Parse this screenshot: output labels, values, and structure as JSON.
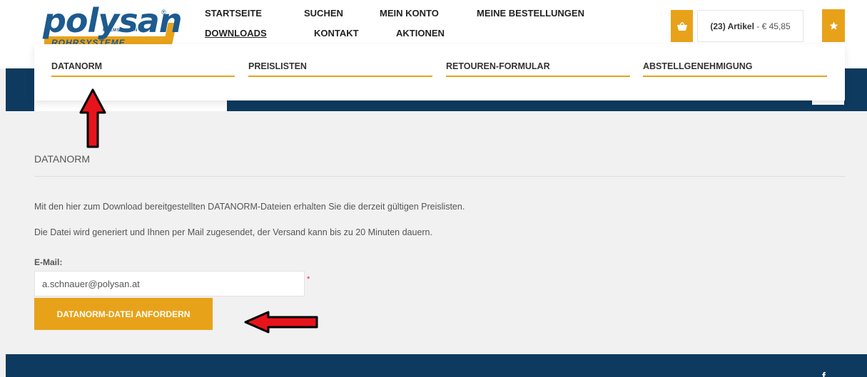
{
  "logo": {
    "brand": "polysan",
    "sub": "KREMS · WIEN",
    "tagline": "ROHRSYSTEME",
    "registered": "®"
  },
  "nav": {
    "row1": [
      "STARTSEITE",
      "SUCHEN",
      "MEIN KONTO",
      "MEINE BESTELLUNGEN"
    ],
    "row2": [
      "DOWNLOADS",
      "KONTAKT",
      "AKTIONEN"
    ]
  },
  "cart": {
    "count": "(23) Artikel",
    "separator": " - ",
    "total": "€ 45,85"
  },
  "icons": {
    "cart": "basket-icon",
    "favorites": "star-icon",
    "social": "facebook-icon"
  },
  "dropdown": {
    "items": [
      "DATANORM",
      "PREISLISTEN",
      "RETOUREN-FORMULAR",
      "ABSTELLGENEHMIGUNG"
    ]
  },
  "content": {
    "title": "DATANORM",
    "p1": "Mit den hier zum Download bereitgestellten DATANORM-Dateien erhalten Sie die derzeit gültigen Preislisten.",
    "p2": "Die Datei wird generiert und Ihnen per Mail zugesendet, der Versand kann bis zu 20 Minuten dauern.",
    "email_label": "E-Mail:",
    "email_value": "a.schnauer@polysan.at",
    "required": "*",
    "submit": "DATANORM-DATEI ANFORDERN"
  },
  "footer": {
    "social": "f"
  },
  "colors": {
    "accent": "#e8a21a",
    "navy": "#0e3a5f",
    "brand_blue": "#1d5a8e",
    "annotation_red": "#e8141c"
  }
}
